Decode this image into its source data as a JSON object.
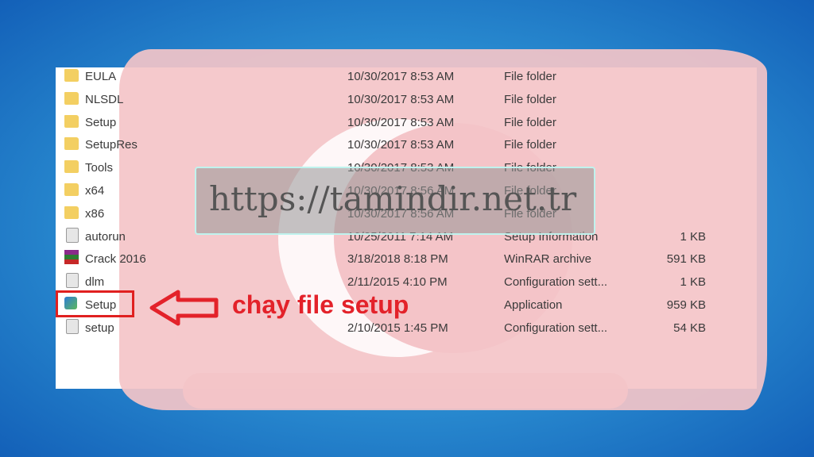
{
  "files": [
    {
      "name": "EULA",
      "date": "10/30/2017 8:53 AM",
      "type": "File folder",
      "size": "",
      "icon": "folder-icon"
    },
    {
      "name": "NLSDL",
      "date": "10/30/2017 8:53 AM",
      "type": "File folder",
      "size": "",
      "icon": "folder-icon"
    },
    {
      "name": "Setup",
      "date": "10/30/2017 8:53 AM",
      "type": "File folder",
      "size": "",
      "icon": "folder-icon"
    },
    {
      "name": "SetupRes",
      "date": "10/30/2017 8:53 AM",
      "type": "File folder",
      "size": "",
      "icon": "folder-icon"
    },
    {
      "name": "Tools",
      "date": "10/30/2017 8:53 AM",
      "type": "File folder",
      "size": "",
      "icon": "folder-icon"
    },
    {
      "name": "x64",
      "date": "10/30/2017 8:56 AM",
      "type": "File folder",
      "size": "",
      "icon": "folder-icon"
    },
    {
      "name": "x86",
      "date": "10/30/2017 8:56 AM",
      "type": "File folder",
      "size": "",
      "icon": "folder-icon"
    },
    {
      "name": "autorun",
      "date": "10/25/2011 7:14 AM",
      "type": "Setup Information",
      "size": "1 KB",
      "icon": "config-file-icon"
    },
    {
      "name": "Crack 2016",
      "date": "3/18/2018 8:18 PM",
      "type": "WinRAR archive",
      "size": "591 KB",
      "icon": "winrar-icon"
    },
    {
      "name": "dlm",
      "date": "2/11/2015 4:10 PM",
      "type": "Configuration sett...",
      "size": "1 KB",
      "icon": "config-file-icon"
    },
    {
      "name": "Setup",
      "date": "",
      "type": "Application",
      "size": "959 KB",
      "icon": "application-icon"
    },
    {
      "name": "setup",
      "date": "2/10/2015 1:45 PM",
      "type": "Configuration sett...",
      "size": "54 KB",
      "icon": "config-file-icon"
    }
  ],
  "watermark": "https://tamindir.net.tr",
  "annotation": "chạy file setup",
  "colors": {
    "accent_red": "#e3222a",
    "overlay_pink": "#f4c4c8",
    "background_blue": "#2b8fd2"
  }
}
